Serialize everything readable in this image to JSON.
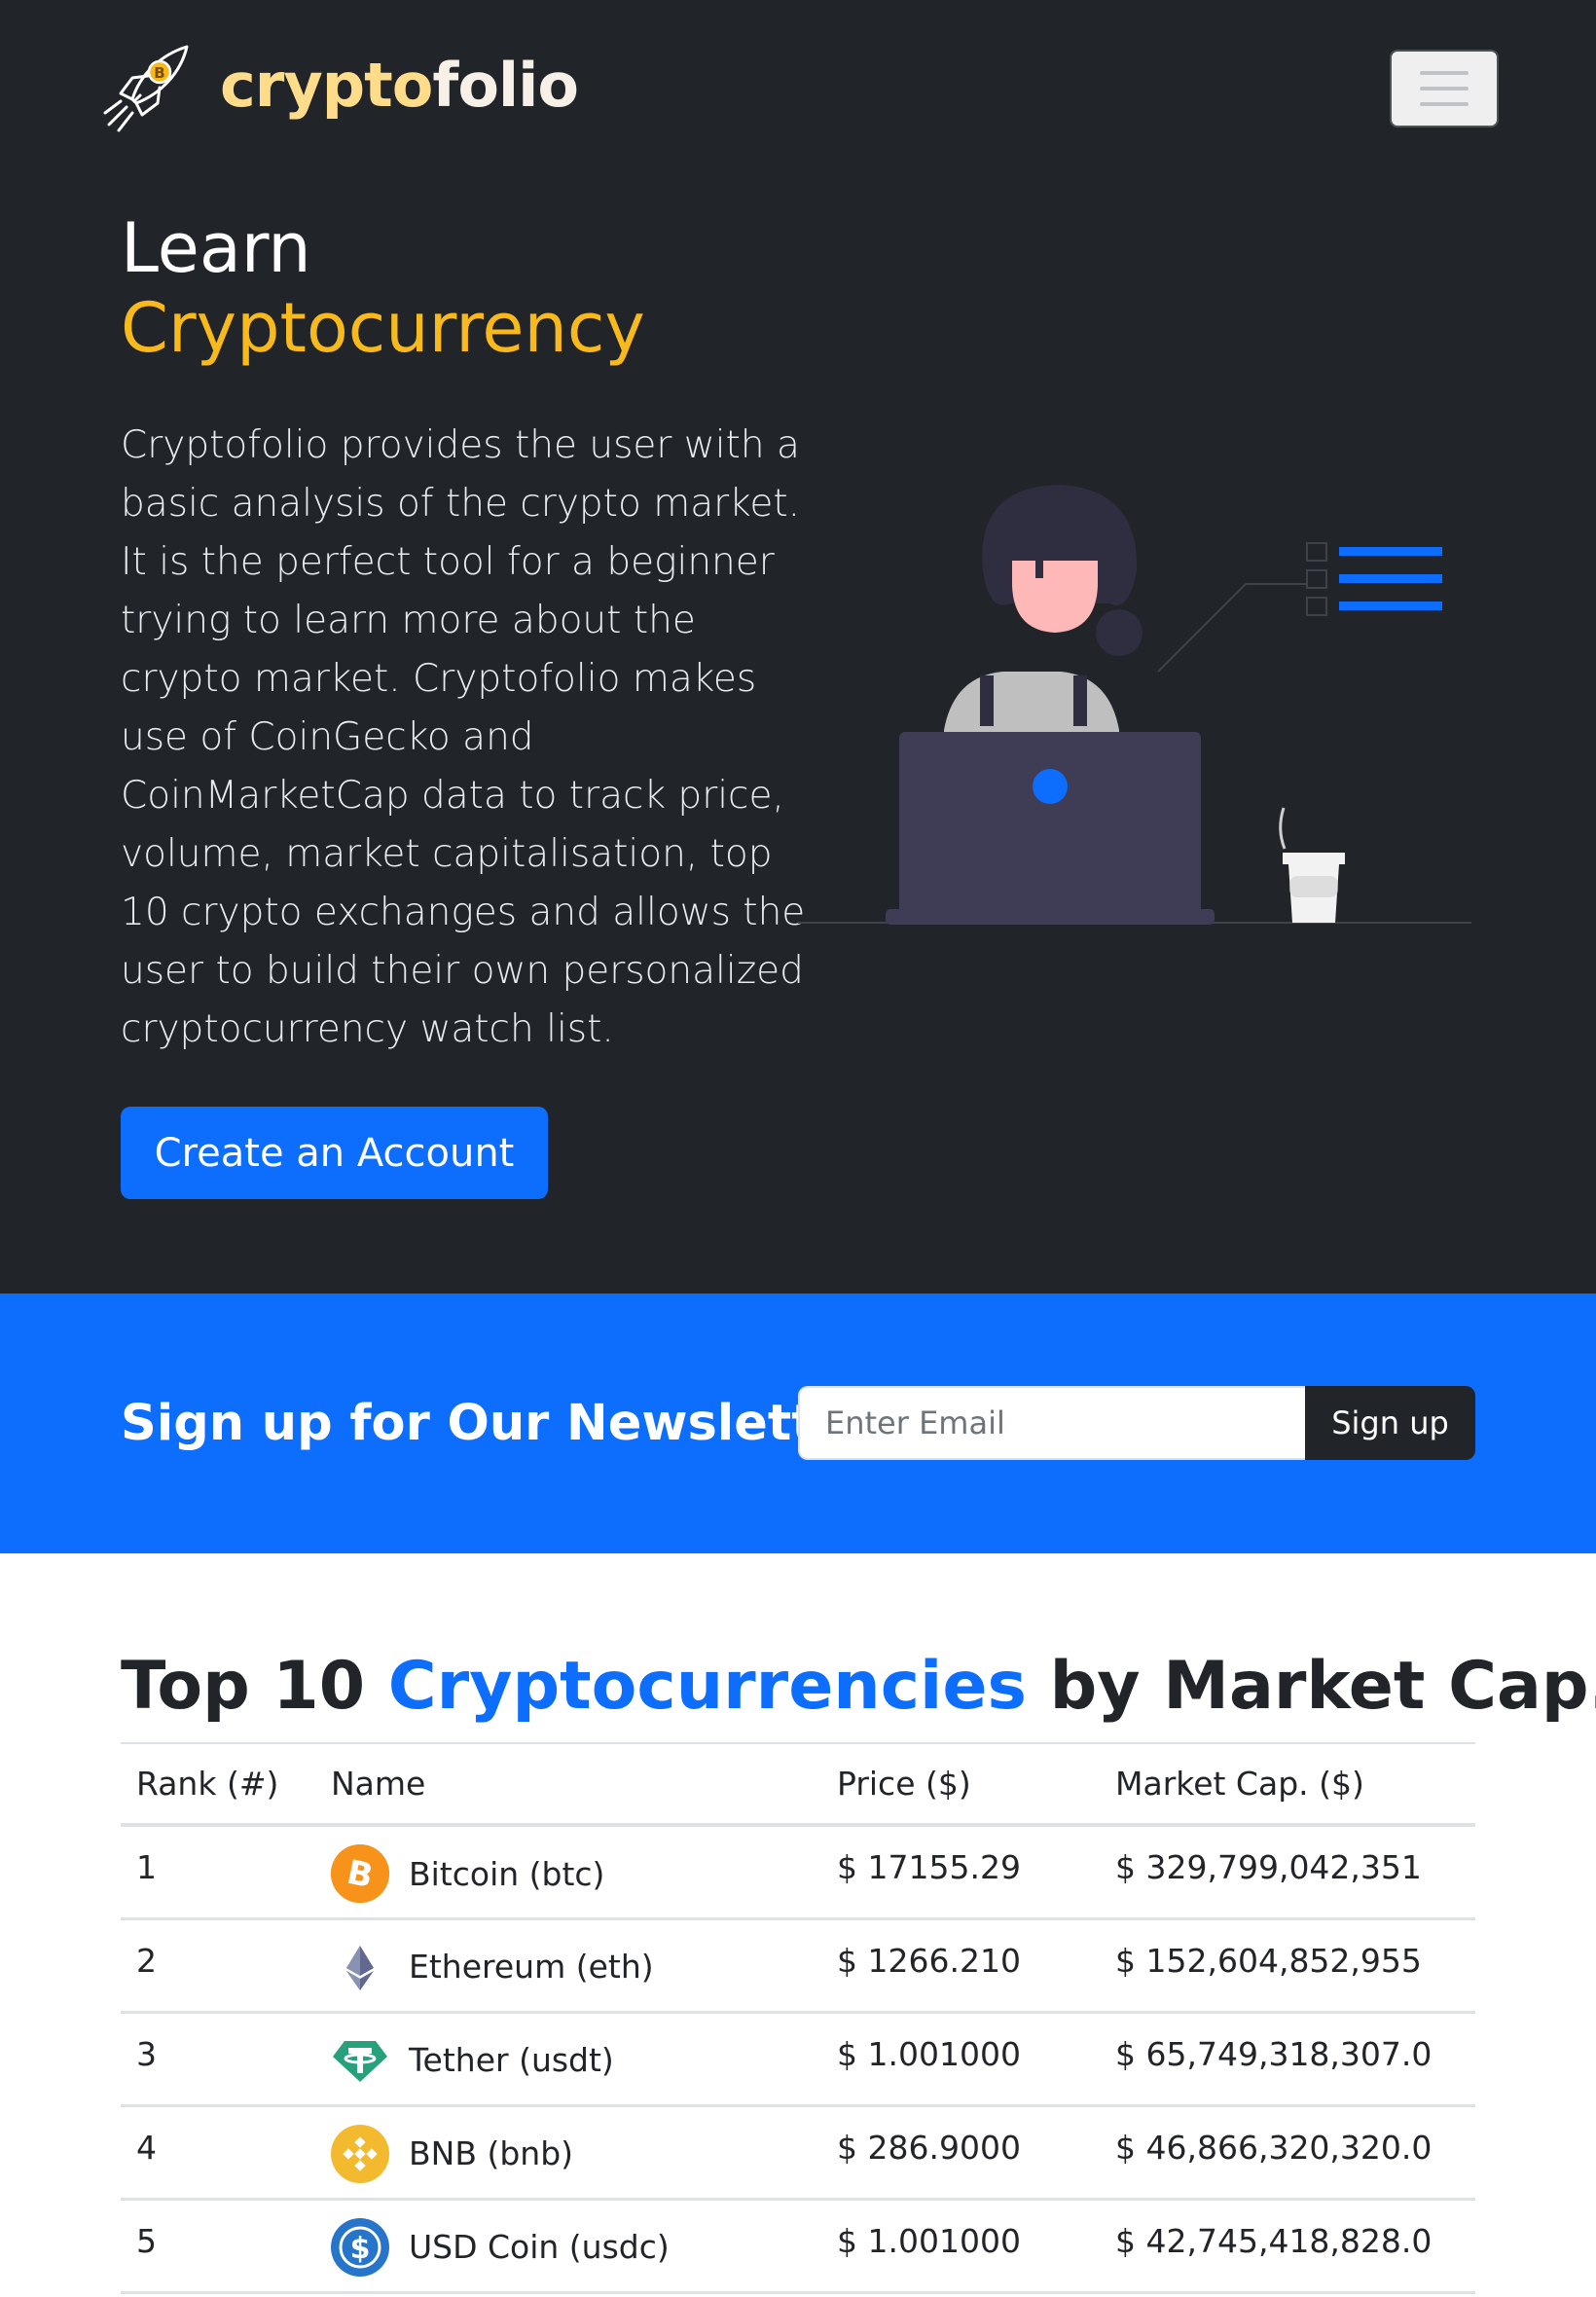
{
  "navbar": {
    "brand_part1": "crypto",
    "brand_part2": "folio",
    "logo_icon": "rocket-bitcoin-icon",
    "menu_icon": "hamburger-icon"
  },
  "hero": {
    "title_line1": "Learn",
    "title_line2": "Cryptocurrency",
    "description": "Cryptofolio provides the user with a basic analysis of the crypto market. It is the perfect tool for a beginner trying to learn more about the crypto market. Cryptofolio makes use of CoinGecko and CoinMarketCap data to track price, volume, market capitalisation, top 10 crypto exchanges and allows the user to build their own personalized cryptocurrency watch list.",
    "cta_label": "Create an Account"
  },
  "newsletter": {
    "title": "Sign up for Our Newsletter",
    "email_placeholder": "Enter Email",
    "button_label": "Sign up"
  },
  "top_coins": {
    "title_prefix": "Top 10 ",
    "title_accent": "Cryptocurrencies",
    "title_suffix": " by Market Cap.",
    "headers": {
      "rank": "Rank (#)",
      "name": "Name",
      "price": "Price ($)",
      "market_cap": "Market Cap. ($)"
    },
    "rows": [
      {
        "rank": "1",
        "name": "Bitcoin (btc)",
        "price": "$ 17155.29",
        "market_cap": "$ 329,799,042,351",
        "icon": "bitcoin-icon"
      },
      {
        "rank": "2",
        "name": "Ethereum (eth)",
        "price": "$ 1266.210",
        "market_cap": "$ 152,604,852,955",
        "icon": "ethereum-icon"
      },
      {
        "rank": "3",
        "name": "Tether (usdt)",
        "price": "$ 1.001000",
        "market_cap": "$ 65,749,318,307.0",
        "icon": "tether-icon"
      },
      {
        "rank": "4",
        "name": "BNB (bnb)",
        "price": "$ 286.9000",
        "market_cap": "$ 46,866,320,320.0",
        "icon": "bnb-icon"
      },
      {
        "rank": "5",
        "name": "USD Coin (usdc)",
        "price": "$ 1.001000",
        "market_cap": "$ 42,745,418,828.0",
        "icon": "usdc-icon"
      }
    ]
  },
  "colors": {
    "dark_bg": "#212529",
    "accent_yellow": "#f7b91c",
    "primary_blue": "#0d6efd"
  }
}
